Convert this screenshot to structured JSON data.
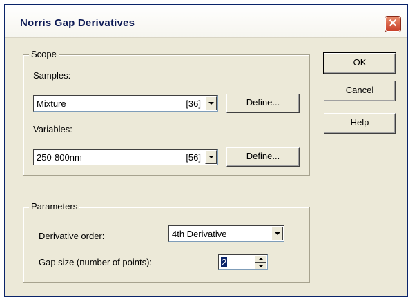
{
  "window": {
    "title": "Norris Gap Derivatives",
    "close_glyph": "✕"
  },
  "scope": {
    "legend": "Scope",
    "samples_label": "Samples:",
    "samples_value": "Mixture",
    "samples_count": "[36]",
    "variables_label": "Variables:",
    "variables_value": "250-800nm",
    "variables_count": "[56]",
    "define_label": "Define..."
  },
  "parameters": {
    "legend": "Parameters",
    "derivative_label": "Derivative order:",
    "derivative_value": "4th Derivative",
    "gap_label": "Gap size (number of points):",
    "gap_value": "2"
  },
  "buttons": {
    "ok": "OK",
    "cancel": "Cancel",
    "help": "Help"
  },
  "colors": {
    "dialog_bg": "#ece9d8",
    "title_text": "#0d1a55",
    "close_btn": "#c8402a",
    "selection": "#0a246a"
  }
}
